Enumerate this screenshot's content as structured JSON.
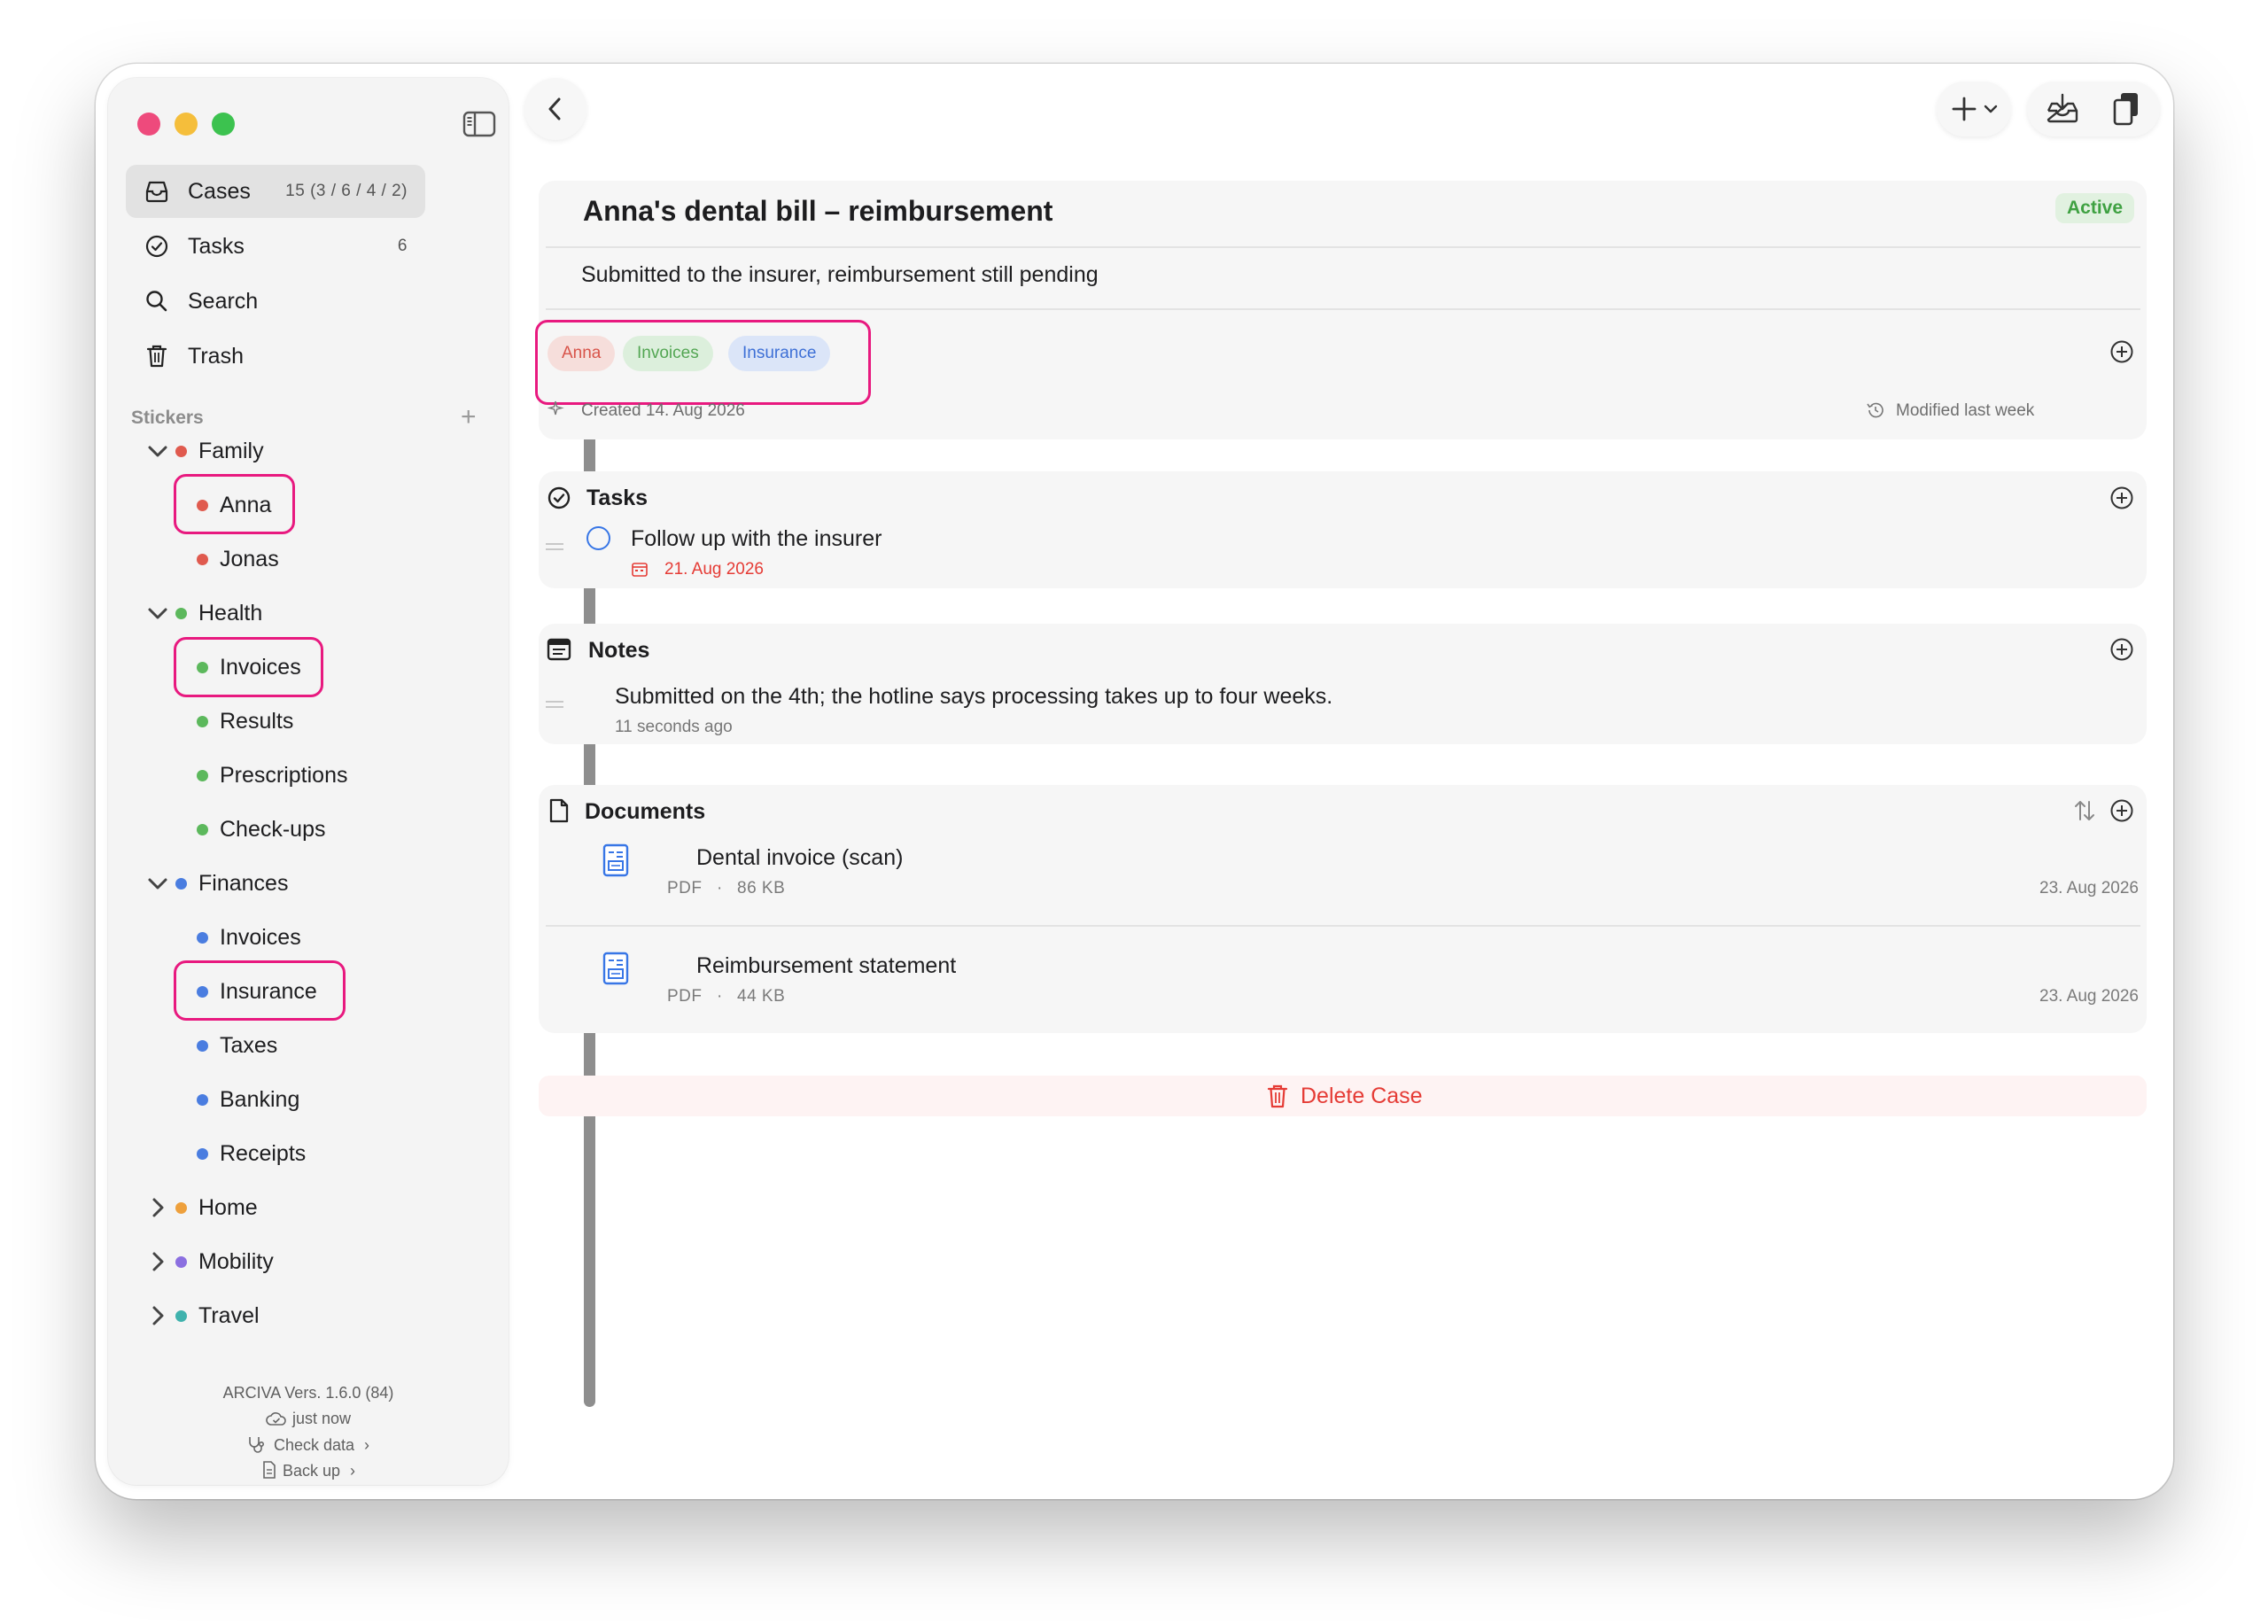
{
  "sidebar": {
    "nav": [
      {
        "label": "Cases",
        "count": "15  (3 / 6 / 4 / 2)",
        "icon": "tray-icon",
        "selected": true
      },
      {
        "label": "Tasks",
        "count": "6",
        "icon": "checkmark-circle-icon"
      },
      {
        "label": "Search",
        "count": "",
        "icon": "magnifier-icon"
      },
      {
        "label": "Trash",
        "count": "",
        "icon": "trash-icon"
      }
    ],
    "stickers_heading": "Stickers",
    "add_symbol": "+",
    "groups": {
      "family": {
        "label": "Family",
        "color": "#e05a4e",
        "children": [
          "Anna",
          "Jonas"
        ]
      },
      "health": {
        "label": "Health",
        "color": "#5cb85c",
        "children": [
          "Invoices",
          "Results",
          "Prescriptions",
          "Check-ups"
        ]
      },
      "finances": {
        "label": "Finances",
        "color": "#4a7de0",
        "children": [
          "Invoices",
          "Insurance",
          "Taxes",
          "Banking",
          "Receipts"
        ]
      },
      "home": {
        "label": "Home",
        "color": "#eea03c"
      },
      "mobility": {
        "label": "Mobility",
        "color": "#8b6fe0"
      },
      "travel": {
        "label": "Travel",
        "color": "#3fb2ad"
      }
    },
    "footer": {
      "app_version": "ARCIVA  Vers. 1.6.0 (84)",
      "sync_status": "just now",
      "check_data": "Check data",
      "back_up": "Back up",
      "chevron": "›"
    }
  },
  "case": {
    "title": "Anna's dental bill – reimbursement",
    "status": "Active",
    "description": "Submitted to the insurer, reimbursement still pending",
    "tags": [
      {
        "label": "Anna",
        "text_color": "#d8544a",
        "bg": "#f6dedb"
      },
      {
        "label": "Invoices",
        "text_color": "#53a653",
        "bg": "#dcefdc"
      },
      {
        "label": "Insurance",
        "text_color": "#3e70d6",
        "bg": "#dbe5f8"
      }
    ],
    "created": "Created 14. Aug 2026",
    "modified": "Modified last week"
  },
  "tasks": {
    "heading": "Tasks",
    "items": [
      {
        "title": "Follow up with the insurer",
        "due": "21. Aug 2026"
      }
    ]
  },
  "notes": {
    "heading": "Notes",
    "items": [
      {
        "text": "Submitted on the 4th; the hotline says processing takes up to four weeks.",
        "time": "11 seconds ago"
      }
    ]
  },
  "documents": {
    "heading": "Documents",
    "items": [
      {
        "name": "Dental invoice (scan)",
        "type": "PDF",
        "sep": "·",
        "size": "86 KB",
        "date": "23. Aug 2026"
      },
      {
        "name": "Reimbursement statement",
        "type": "PDF",
        "sep": "·",
        "size": "44 KB",
        "date": "23. Aug 2026"
      }
    ]
  },
  "delete_label": "Delete Case",
  "colors": {
    "accent_blue": "#3876e6",
    "danger_red": "#e53b35",
    "highlight_pink": "#e8197f",
    "active_green": "#3fa142"
  }
}
